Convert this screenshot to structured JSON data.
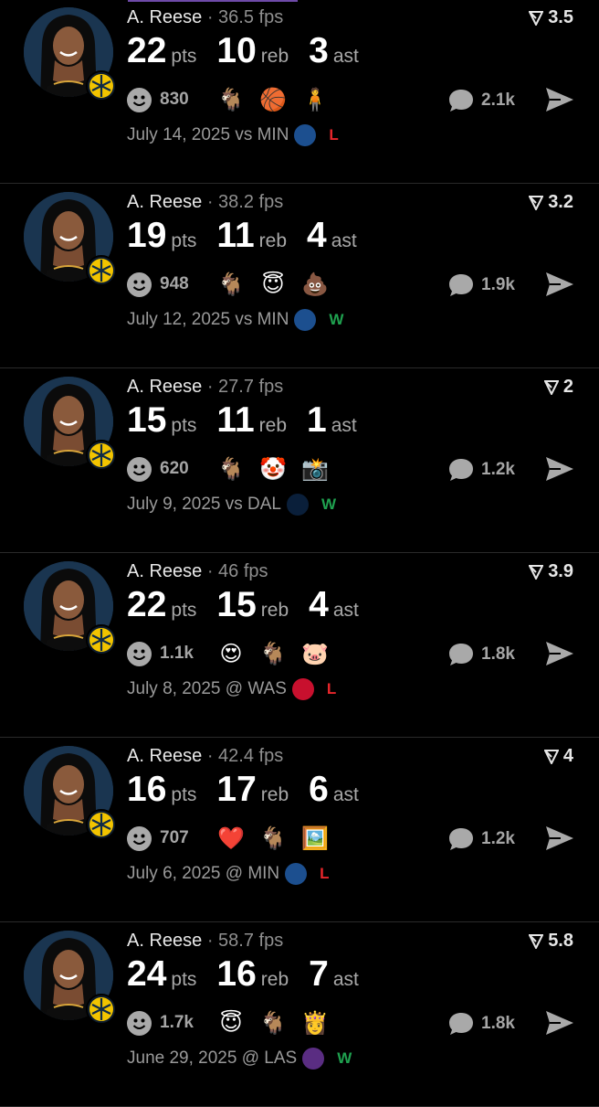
{
  "colors": {
    "win": "#1fa14f",
    "loss": "#e8262b",
    "accent": "#6e4aa8"
  },
  "games": [
    {
      "name": "A. Reese",
      "fps": "36.5 fps",
      "rating": "3.5",
      "pts": "22",
      "reb": "10",
      "ast": "3",
      "pts_unit": "pts",
      "reb_unit": "reb",
      "ast_unit": "ast",
      "likes": "830",
      "emojis": [
        "goat-emoji",
        "basketball-hoop-emoji",
        "fire-figure-emoji"
      ],
      "comments": "2.1k",
      "date": "July 14, 2025",
      "venue": "vs MIN",
      "opponent": "MIN",
      "result": "L"
    },
    {
      "name": "A. Reese",
      "fps": "38.2 fps",
      "rating": "3.2",
      "pts": "19",
      "reb": "11",
      "ast": "4",
      "pts_unit": "pts",
      "reb_unit": "reb",
      "ast_unit": "ast",
      "likes": "948",
      "emojis": [
        "goat-emoji",
        "angel-emoji",
        "poop-emoji"
      ],
      "comments": "1.9k",
      "date": "July 12, 2025",
      "venue": "vs MIN",
      "opponent": "MIN",
      "result": "W"
    },
    {
      "name": "A. Reese",
      "fps": "27.7 fps",
      "rating": "2",
      "pts": "15",
      "reb": "11",
      "ast": "1",
      "pts_unit": "pts",
      "reb_unit": "reb",
      "ast_unit": "ast",
      "likes": "620",
      "emojis": [
        "goat-emoji",
        "clown-emoji",
        "camera-flash-emoji"
      ],
      "comments": "1.2k",
      "date": "July 9, 2025",
      "venue": "vs DAL",
      "opponent": "DAL",
      "result": "W"
    },
    {
      "name": "A. Reese",
      "fps": "46 fps",
      "rating": "3.9",
      "pts": "22",
      "reb": "15",
      "ast": "4",
      "pts_unit": "pts",
      "reb_unit": "reb",
      "ast_unit": "ast",
      "likes": "1.1k",
      "emojis": [
        "heart-eyes-emoji",
        "goat-emoji",
        "pig-emoji"
      ],
      "comments": "1.8k",
      "date": "July 8, 2025",
      "venue": "@ WAS",
      "opponent": "WAS",
      "result": "L"
    },
    {
      "name": "A. Reese",
      "fps": "42.4 fps",
      "rating": "4",
      "pts": "16",
      "reb": "17",
      "ast": "6",
      "pts_unit": "pts",
      "reb_unit": "reb",
      "ast_unit": "ast",
      "likes": "707",
      "emojis": [
        "red-heart-emoji",
        "goat-emoji",
        "photo-emoji"
      ],
      "comments": "1.2k",
      "date": "July 6, 2025",
      "venue": "@ MIN",
      "opponent": "MIN",
      "result": "L"
    },
    {
      "name": "A. Reese",
      "fps": "58.7 fps",
      "rating": "5.8",
      "pts": "24",
      "reb": "16",
      "ast": "7",
      "pts_unit": "pts",
      "reb_unit": "reb",
      "ast_unit": "ast",
      "likes": "1.7k",
      "emojis": [
        "angel-emoji",
        "goat-emoji",
        "queen-emoji"
      ],
      "comments": "1.8k",
      "date": "June 29, 2025",
      "venue": "@ LAS",
      "opponent": "LAS",
      "result": "W"
    }
  ]
}
